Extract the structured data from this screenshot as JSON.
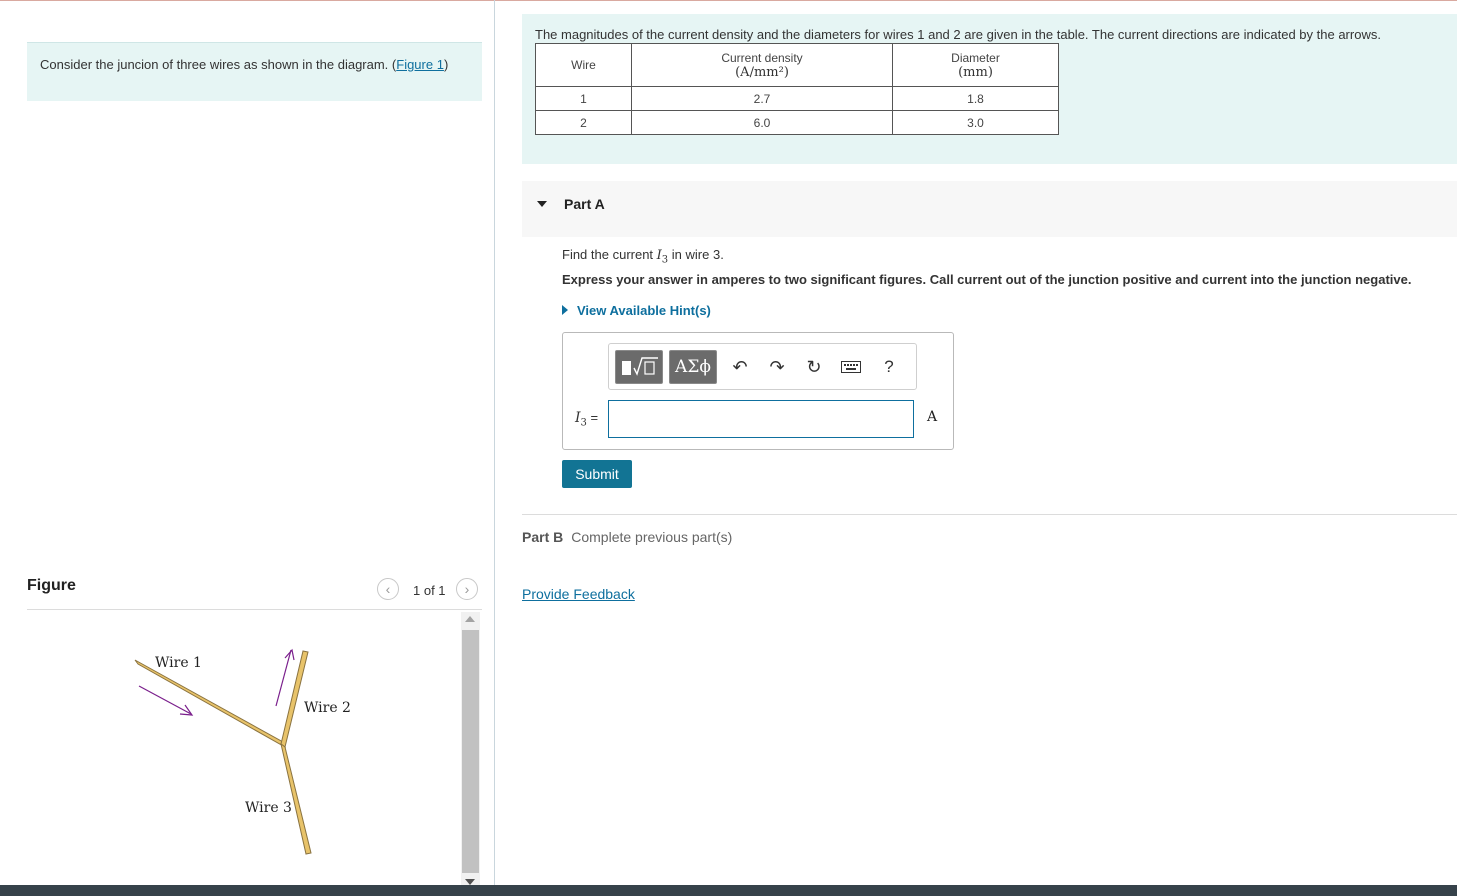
{
  "left": {
    "intro_text": "Consider the juncion of three wires as shown in the diagram. (",
    "intro_link": "Figure 1",
    "intro_close": ")",
    "figure_title": "Figure",
    "figure_count": "1 of 1",
    "prev_icon": "chevron-left-icon",
    "next_icon": "chevron-right-icon"
  },
  "figure": {
    "wire1_label": "Wire 1",
    "wire2_label": "Wire 2",
    "wire3_label": "Wire 3",
    "wire_color": "#e8c36a",
    "arrow_color": "#7a1f8c"
  },
  "problem": {
    "text": "The magnitudes of the current density and the diameters for wires 1 and 2 are given in the table. The current directions are indicated by the arrows.",
    "table": {
      "headers": [
        "Wire",
        "Current density",
        "Diameter"
      ],
      "units": [
        "",
        "(A/mm²)",
        "(mm)"
      ],
      "rows": [
        [
          "1",
          "2.7",
          "1.8"
        ],
        [
          "2",
          "6.0",
          "3.0"
        ]
      ]
    }
  },
  "partA": {
    "title": "Part A",
    "find_prefix": "Find the current ",
    "find_var": "I",
    "find_sub": "3",
    "find_suffix": " in wire 3.",
    "express": "Express your answer in amperes to two significant figures. Call current out of the junction positive and current into the junction negative.",
    "hint": "View Available Hint(s)",
    "var_label": "I",
    "var_sub": "3",
    "var_eq": " =",
    "input_value": "",
    "unit": "A",
    "submit": "Submit",
    "toolbar": {
      "symbols_label": "ΑΣϕ",
      "help_label": "?",
      "icons": [
        "template-icon",
        "undo-icon",
        "redo-icon",
        "reset-icon",
        "keyboard-icon",
        "help-icon"
      ]
    }
  },
  "partB": {
    "title": "Part B",
    "status": "Complete previous part(s)"
  },
  "feedback": "Provide Feedback",
  "colors": {
    "teal_panel": "#e6f5f4",
    "link": "#0e6f9e",
    "submit": "#127494",
    "bottom_bar": "#36424a"
  }
}
